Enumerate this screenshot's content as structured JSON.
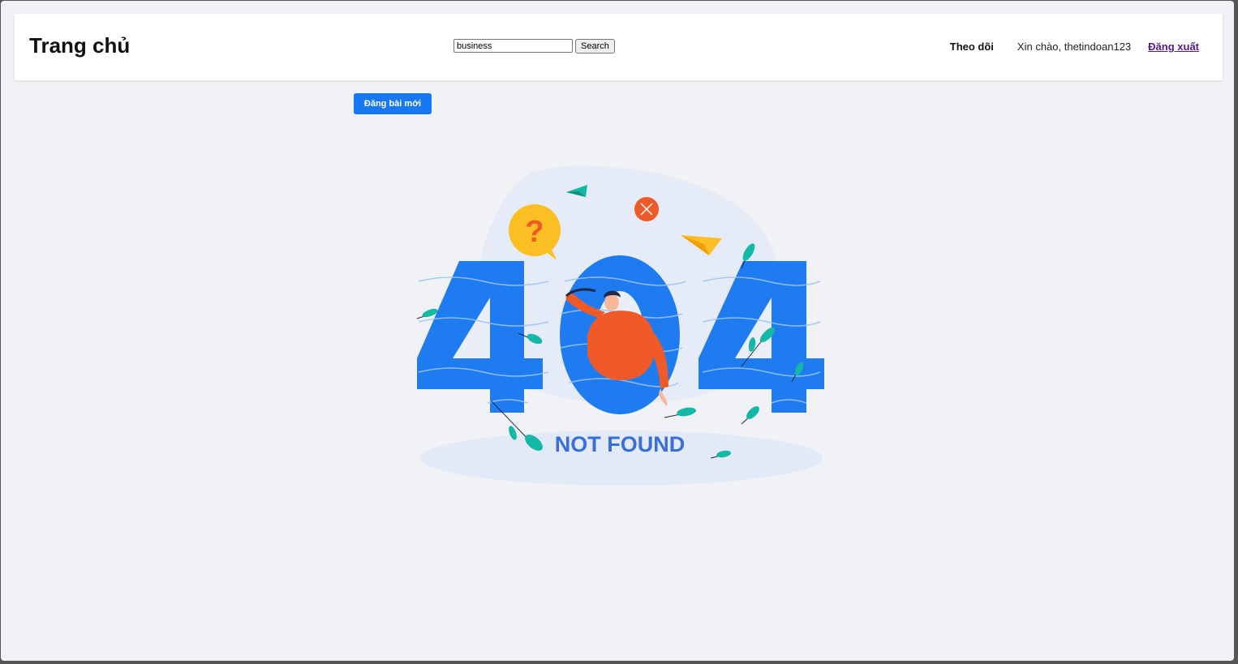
{
  "header": {
    "title": "Trang chủ",
    "search": {
      "value": "business",
      "button_label": "Search"
    },
    "follow_label": "Theo dõi",
    "greeting": "Xin chào, thetindoan123",
    "logout_label": "Đăng xuất"
  },
  "main": {
    "new_post_label": "Đăng bài mới",
    "error_code": "404",
    "error_text": "NOT FOUND"
  },
  "colors": {
    "accent": "#1877f2",
    "illustration_blue": "#1e7bf0",
    "person_orange": "#f05a28",
    "question_yellow": "#fbbf24",
    "leaf_teal": "#14b8a6"
  }
}
